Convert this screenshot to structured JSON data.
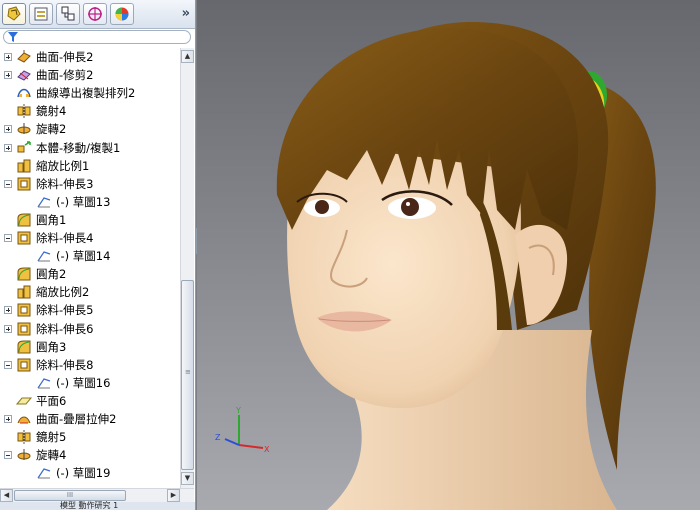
{
  "panel": {
    "tabs": [
      {
        "icon": "feature-manager-icon"
      },
      {
        "icon": "property-manager-icon"
      },
      {
        "icon": "configuration-manager-icon"
      },
      {
        "icon": "dimxpert-icon"
      },
      {
        "icon": "display-manager-icon"
      }
    ],
    "more_label": "»",
    "filter_icon": "filter-icon",
    "tree": [
      {
        "label": "曲面-伸長2",
        "icon": "surface-extrude-icon",
        "expander": "plus",
        "indent": 0
      },
      {
        "label": "曲面-修剪2",
        "icon": "surface-trim-icon",
        "expander": "plus",
        "indent": 0
      },
      {
        "label": "曲線導出複製排列2",
        "icon": "curve-pattern-icon",
        "expander": "none",
        "indent": 0
      },
      {
        "label": "鏡射4",
        "icon": "mirror-icon",
        "expander": "none",
        "indent": 0
      },
      {
        "label": "旋轉2",
        "icon": "revolve-icon",
        "expander": "plus",
        "indent": 0
      },
      {
        "label": "本體-移動/複製1",
        "icon": "move-copy-icon",
        "expander": "plus",
        "indent": 0
      },
      {
        "label": "縮放比例1",
        "icon": "scale-icon",
        "expander": "none",
        "indent": 0
      },
      {
        "label": "除料-伸長3",
        "icon": "cut-extrude-icon",
        "expander": "minus",
        "indent": 0
      },
      {
        "label": "(-) 草圖13",
        "icon": "sketch-icon",
        "expander": "none",
        "indent": 1
      },
      {
        "label": "圓角1",
        "icon": "fillet-icon",
        "expander": "none",
        "indent": 0
      },
      {
        "label": "除料-伸長4",
        "icon": "cut-extrude-icon",
        "expander": "minus",
        "indent": 0
      },
      {
        "label": "(-) 草圖14",
        "icon": "sketch-icon",
        "expander": "none",
        "indent": 1
      },
      {
        "label": "圓角2",
        "icon": "fillet-icon",
        "expander": "none",
        "indent": 0
      },
      {
        "label": "縮放比例2",
        "icon": "scale-icon",
        "expander": "none",
        "indent": 0
      },
      {
        "label": "除料-伸長5",
        "icon": "cut-extrude-icon",
        "expander": "plus",
        "indent": 0
      },
      {
        "label": "除料-伸長6",
        "icon": "cut-extrude-icon",
        "expander": "plus",
        "indent": 0
      },
      {
        "label": "圓角3",
        "icon": "fillet-icon",
        "expander": "none",
        "indent": 0
      },
      {
        "label": "除料-伸長8",
        "icon": "cut-extrude-icon",
        "expander": "minus",
        "indent": 0
      },
      {
        "label": "(-) 草圖16",
        "icon": "sketch-icon",
        "expander": "none",
        "indent": 1
      },
      {
        "label": "平面6",
        "icon": "plane-icon",
        "expander": "none",
        "indent": 0
      },
      {
        "label": "曲面-疊層拉伸2",
        "icon": "surface-loft-icon",
        "expander": "plus",
        "indent": 0
      },
      {
        "label": "鏡射5",
        "icon": "mirror-icon",
        "expander": "none",
        "indent": 0
      },
      {
        "label": "旋轉4",
        "icon": "revolve-icon",
        "expander": "minus",
        "indent": 0
      },
      {
        "label": "(-) 草圖19",
        "icon": "sketch-icon",
        "expander": "none",
        "indent": 1
      }
    ],
    "scroll_grip": "≡",
    "hscroll_grip": "III",
    "bottom_text": "模型   動作研究 1"
  },
  "viewport": {
    "model": "3d-head-model",
    "triad_icon": "reference-triad-icon",
    "colors": {
      "hair": "#6e4a10",
      "skin": "#f2d6b8",
      "hair_tie_green": "#2ea830",
      "hair_tie_yellow": "#e6d21e"
    }
  }
}
